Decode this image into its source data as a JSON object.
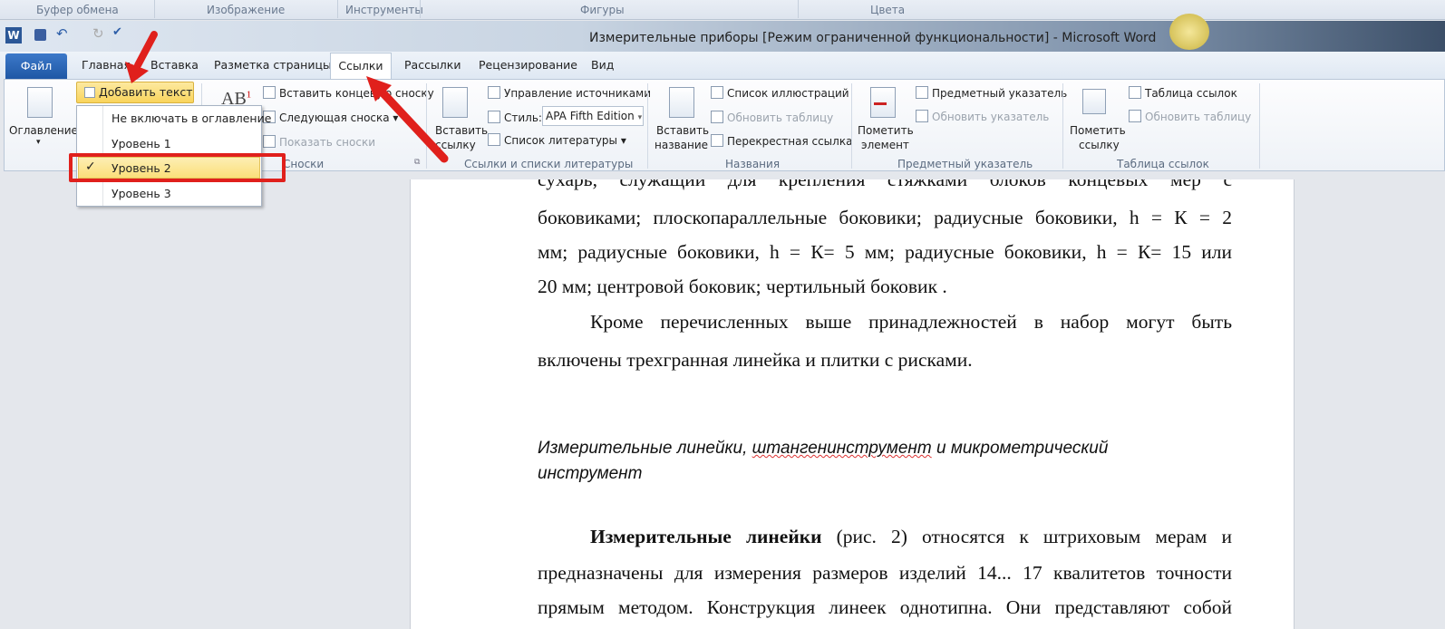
{
  "prev_ribbon_groups": [
    "Буфер обмена",
    "Изображение",
    "Инструменты",
    "Фигуры",
    "Цвета"
  ],
  "window_title": "Измерительные приборы [Режим ограниченной функциональности]  -  Microsoft Word",
  "tabs": {
    "file": "Файл",
    "items": [
      "Главная",
      "Вставка",
      "Разметка страницы",
      "Ссылки",
      "Рассылки",
      "Рецензирование",
      "Вид"
    ],
    "active": "Ссылки"
  },
  "ribbon": {
    "toc": {
      "button": "Оглавление",
      "add_text": "Добавить текст"
    },
    "footnotes": {
      "insert_endnote": "Вставить концевую сноску",
      "next_footnote": "Следующая сноска",
      "show_notes": "Показать сноски",
      "group": "Сноски"
    },
    "citations": {
      "insert_citation_1": "Вставить",
      "insert_citation_2": "ссылку",
      "manage_sources": "Управление источниками",
      "style_label": "Стиль:",
      "style_value": "APA Fifth Edition",
      "bibliography": "Список литературы",
      "group": "Ссылки и списки литературы"
    },
    "captions": {
      "insert_caption_1": "Вставить",
      "insert_caption_2": "название",
      "table_of_figures": "Список иллюстраций",
      "update_table": "Обновить таблицу",
      "cross_reference": "Перекрестная ссылка",
      "group": "Названия"
    },
    "index": {
      "mark_entry_1": "Пометить",
      "mark_entry_2": "элемент",
      "insert_index": "Предметный указатель",
      "update_index": "Обновить указатель",
      "group": "Предметный указатель"
    },
    "toa": {
      "mark_citation_1": "Пометить",
      "mark_citation_2": "ссылку",
      "insert_toa": "Таблица ссылок",
      "update_table": "Обновить таблицу",
      "group": "Таблица ссылок"
    }
  },
  "add_text_menu": {
    "items": [
      "Не включать в оглавление",
      "Уровень 1",
      "Уровень 2",
      "Уровень 3"
    ],
    "checked": "Уровень 2"
  },
  "document": {
    "lines": [
      "сухарь,   служащий   для   крепления   стяжками   блоков   концевых   мер   с",
      "боковиками; плоскопараллельные боковики; радиусные боковики, h = К = 2",
      "мм; радиусные боковики, h = К= 5 мм; радиусные боковики, h = К= 15 или",
      "20 мм; центровой боковик; чертильный боковик .",
      "Кроме перечисленных выше принадлежностей в набор могут быть",
      "включены трехгранная линейка и плитки с рисками."
    ],
    "heading_1a": "Измерительные линейки, ",
    "heading_1b": "штангенинструмент",
    "heading_1c": "  и микрометрический",
    "heading_2": "инструмент",
    "para_bold": "Измерительные линейки",
    "para_line1_rest": " (рис. 2) относятся к штриховым мерам и",
    "para_line2": "предназначены для измерения размеров изделий 14... 17 квалитетов точности",
    "para_line3": "прямым методом. Конструкция линеек однотипна. Они представляют собой"
  },
  "colors": {
    "accent": "#2b5797",
    "highlight": "#fbdf7a",
    "annotation": "#e0201c"
  }
}
